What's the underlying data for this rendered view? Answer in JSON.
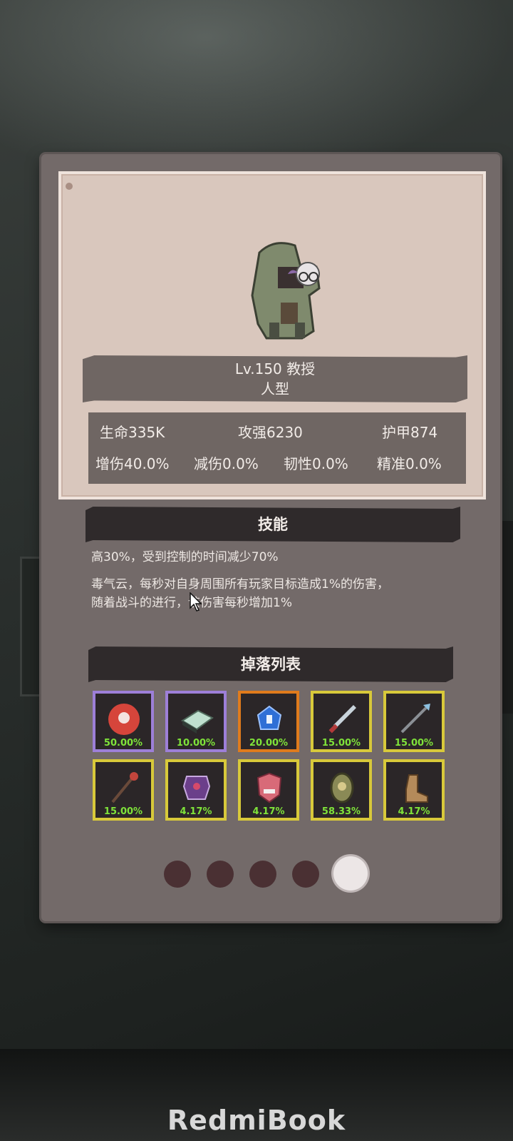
{
  "brand": "RedmiBook",
  "character": {
    "name_line": "Lv.150 教授",
    "type": "人型",
    "portrait_icon": "professor-portrait-icon"
  },
  "stats": {
    "row1": [
      "生命335K",
      "攻强6230",
      "护甲874"
    ],
    "row2": [
      "增伤40.0%",
      "减伤0.0%",
      "韧性0.0%",
      "精准0.0%"
    ]
  },
  "skills": {
    "header": "技能",
    "lines": [
      "高30%，受到控制的时间减少70%",
      "毒气云，每秒对自身周围所有玩家目标造成1%的伤害，",
      "随着战斗的进行，该伤害每秒增加1%"
    ]
  },
  "drops": {
    "header": "掉落列表",
    "items": [
      {
        "icon": "red-orb-icon",
        "pct": "50.00%",
        "rarity": "purple",
        "color": "#d6453b"
      },
      {
        "icon": "book-icon",
        "pct": "10.00%",
        "rarity": "purple",
        "color": "#bfe0cf"
      },
      {
        "icon": "blue-gem-icon",
        "pct": "20.00%",
        "rarity": "orange",
        "color": "#2f6fd6"
      },
      {
        "icon": "sword-icon",
        "pct": "15.00%",
        "rarity": "gold",
        "color": "#c9d4dc"
      },
      {
        "icon": "spear-icon",
        "pct": "15.00%",
        "rarity": "gold",
        "color": "#8cc0e0"
      },
      {
        "icon": "staff-icon",
        "pct": "15.00%",
        "rarity": "gold",
        "color": "#c2453c"
      },
      {
        "icon": "armor-icon",
        "pct": "4.17%",
        "rarity": "gold",
        "color": "#6b3f8a"
      },
      {
        "icon": "mask-icon",
        "pct": "4.17%",
        "rarity": "gold",
        "color": "#d86a78"
      },
      {
        "icon": "shield-icon",
        "pct": "58.33%",
        "rarity": "gold",
        "color": "#8a8a56"
      },
      {
        "icon": "boot-icon",
        "pct": "4.17%",
        "rarity": "gold",
        "color": "#b48a5a"
      }
    ]
  },
  "pager": {
    "count": 5,
    "active": 5
  },
  "colors": {
    "panel": "#736a69",
    "card": "#d9c7bd",
    "banner": "#6f6663",
    "header": "#2f2a2b",
    "drop_pct": "#7fe33a"
  }
}
